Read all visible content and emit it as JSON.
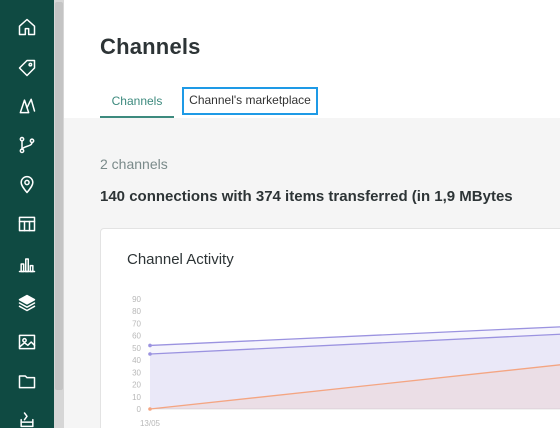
{
  "sidebar": {
    "items": [
      {
        "icon": "home-icon"
      },
      {
        "icon": "tag-icon"
      },
      {
        "icon": "catalog-icon"
      },
      {
        "icon": "branch-icon"
      },
      {
        "icon": "location-pin-icon"
      },
      {
        "icon": "grid-icon"
      },
      {
        "icon": "bar-chart-icon"
      },
      {
        "icon": "layers-icon",
        "active": true
      },
      {
        "icon": "image-icon"
      },
      {
        "icon": "folder-icon"
      },
      {
        "icon": "export-icon"
      }
    ]
  },
  "page": {
    "title": "Channels",
    "tabs": [
      {
        "label": "Channels",
        "active": true
      },
      {
        "label": "Channel's marketplace",
        "focused": true
      }
    ],
    "count": "2 channels",
    "summary": "140 connections with 374 items transferred (in 1,9 MBytes"
  },
  "card": {
    "title": "Channel Activity"
  },
  "colors": {
    "sidebar": "#0f4a42",
    "accent": "#3d8a7e",
    "focus": "#1e9ae6",
    "series_a": "#9b93e0",
    "series_b": "#f4a582"
  },
  "chart_data": {
    "type": "area",
    "x": [
      "13/05"
    ],
    "y_ticks": [
      0,
      10,
      20,
      30,
      40,
      50,
      60,
      70,
      80,
      90
    ],
    "ylim": [
      0,
      90
    ],
    "series": [
      {
        "values": [
          52,
          68
        ]
      },
      {
        "values": [
          45,
          62
        ]
      },
      {
        "values": [
          0,
          38
        ]
      }
    ]
  }
}
